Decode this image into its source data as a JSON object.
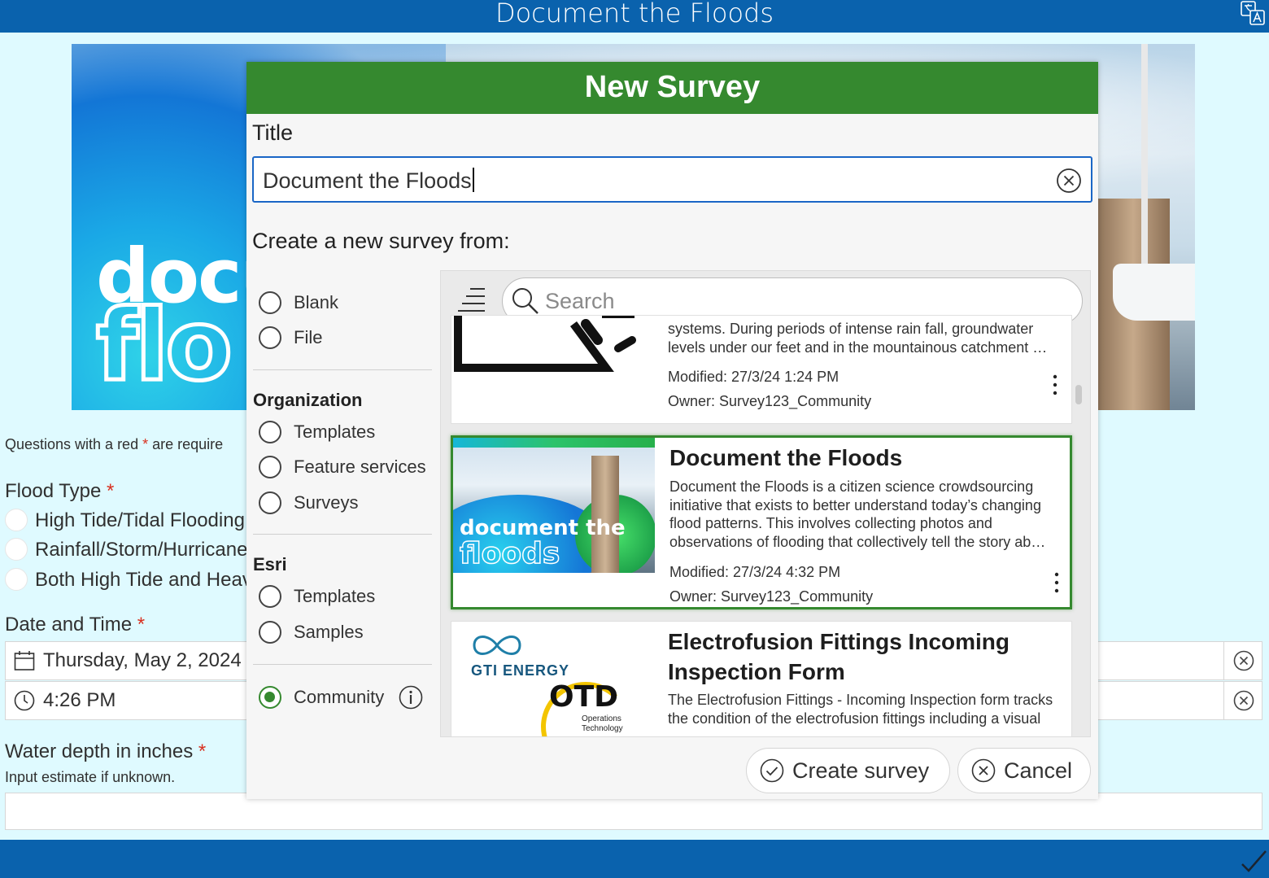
{
  "app": {
    "title": "Document the Floods"
  },
  "banner": {
    "logo_line1": "docu",
    "logo_line2": "flo"
  },
  "form": {
    "required_note_prefix": "Questions with a red",
    "required_note_star": "*",
    "required_note_suffix": "are require",
    "flood_type": {
      "label": "Flood Type",
      "star": "*",
      "options": [
        "High Tide/Tidal Flooding",
        "Rainfall/Storm/Hurricane",
        "Both High Tide and Heav"
      ]
    },
    "datetime": {
      "label": "Date and Time",
      "star": "*",
      "date": "Thursday, May 2, 2024",
      "time": "4:26 PM"
    },
    "water_depth": {
      "label": "Water depth in inches",
      "star": "*",
      "hint": "Input estimate if unknown."
    }
  },
  "dialog": {
    "header": "New Survey",
    "title_label": "Title",
    "title_value": "Document the Floods",
    "create_from_label": "Create a new survey from:",
    "options_top": [
      {
        "label": "Blank",
        "selected": false
      },
      {
        "label": "File",
        "selected": false
      }
    ],
    "organization": {
      "heading": "Organization",
      "options": [
        "Templates",
        "Feature services",
        "Surveys"
      ]
    },
    "esri": {
      "heading": "Esri",
      "options": [
        "Templates",
        "Samples"
      ]
    },
    "community": {
      "label": "Community",
      "selected": true
    },
    "search_placeholder": "Search",
    "cards": [
      {
        "title": "",
        "description": "systems. During periods of intense rain fall, groundwater levels under our feet and in the mountainous catchment …",
        "modified": "Modified: 27/3/24 1:24 PM",
        "owner": "Owner: Survey123_Community",
        "selected": false
      },
      {
        "title": "Document the Floods",
        "description": "Document the Floods is a citizen science crowdsourcing initiative that exists to better understand today’s changing flood patterns. This involves collecting photos and observations of flooding that collectively tell the story ab…",
        "modified": "Modified: 27/3/24 4:32 PM",
        "owner": "Owner: Survey123_Community",
        "thumb_line1": "document the",
        "thumb_line2": "floods",
        "selected": true
      },
      {
        "title": "Electrofusion Fittings Incoming Inspection Form",
        "description": "The Electrofusion Fittings - Incoming Inspection form tracks the condition of the electrofusion fittings including a visual",
        "thumb_brand": "GTI ENERGY",
        "thumb_otd": "OTD",
        "thumb_otd_sub": "Operations",
        "thumb_otd_sub2": "Technology",
        "selected": false
      }
    ],
    "create_button": "Create survey",
    "cancel_button": "Cancel"
  },
  "colors": {
    "topbar": "#0a62ad",
    "dialog_header": "#35892f",
    "accent": "#1a66c6",
    "required": "#d83020"
  },
  "icons": [
    "translate-icon",
    "calendar-icon",
    "clock-icon",
    "clear-icon",
    "sort-icon",
    "search-icon",
    "more-icon",
    "info-icon",
    "check-circle-icon",
    "cancel-circle-icon",
    "submit-check-icon"
  ]
}
